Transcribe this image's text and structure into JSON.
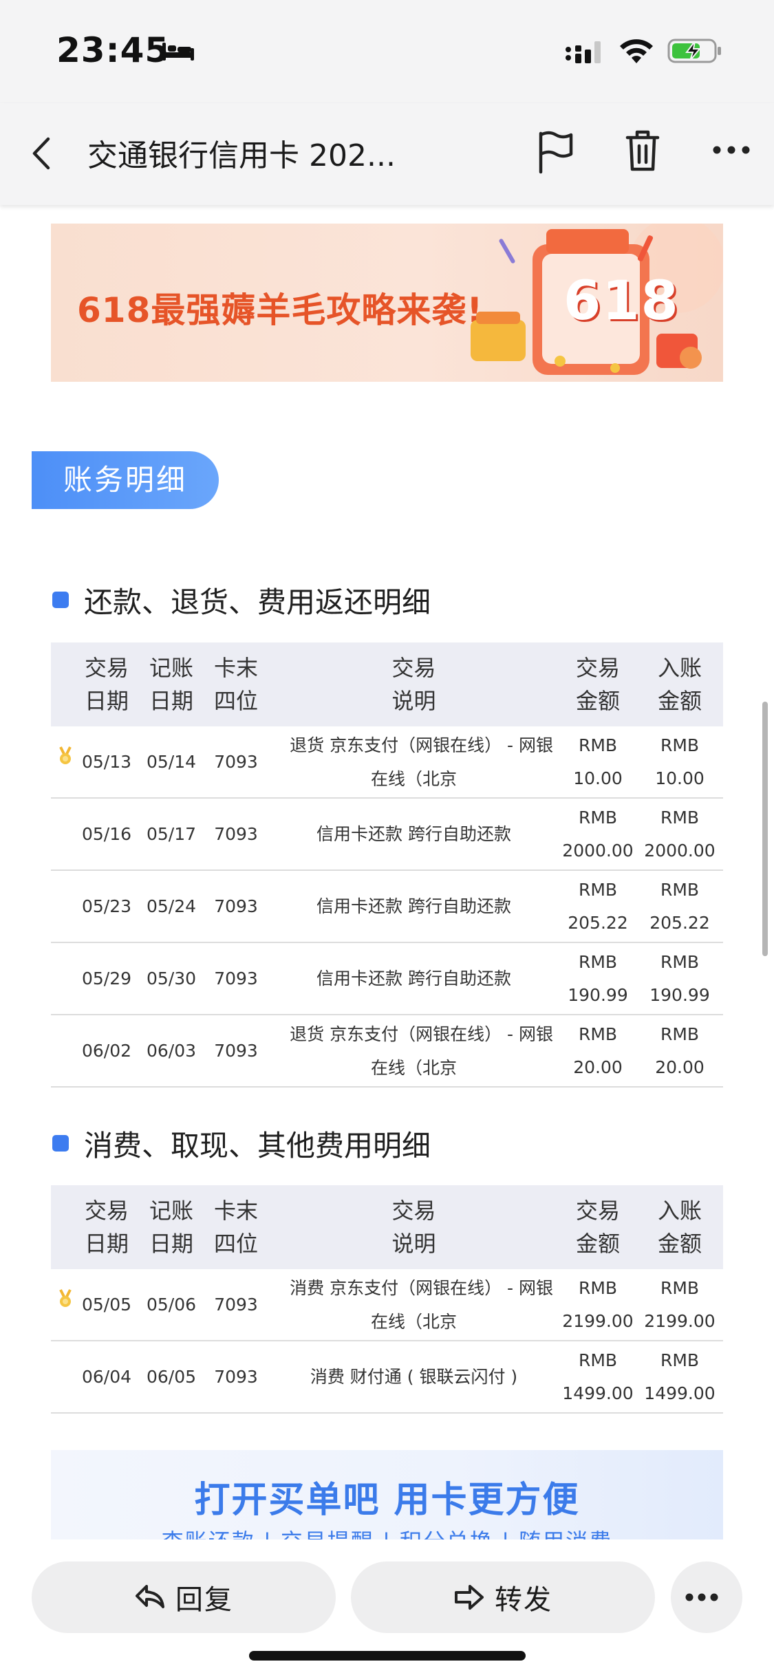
{
  "status_bar": {
    "time": "23:45"
  },
  "nav": {
    "title": "交通银行信用卡 202..."
  },
  "banner": {
    "text": "618最强薅羊毛攻略来袭!",
    "badge": "618"
  },
  "section_badge": "账务明细",
  "headers": [
    "交易\n日期",
    "记账\n日期",
    "卡末\n四位",
    "交易\n说明",
    "交易\n金额",
    "入账\n金额"
  ],
  "repayments": {
    "title": "还款、退货、费用返还明细",
    "rows": [
      {
        "trans_date": "05/13",
        "post_date": "05/14",
        "card": "7093",
        "desc1": "退货 京东支付（网银在线） - 网银",
        "desc2": "在线（北京",
        "cur": "RMB",
        "amount": "10.00",
        "cur2": "RMB",
        "posted": "10.00",
        "medal": true
      },
      {
        "trans_date": "05/16",
        "post_date": "05/17",
        "card": "7093",
        "desc1": "信用卡还款 跨行自助还款",
        "desc2": "",
        "cur": "RMB",
        "amount": "2000.00",
        "cur2": "RMB",
        "posted": "2000.00",
        "medal": false
      },
      {
        "trans_date": "05/23",
        "post_date": "05/24",
        "card": "7093",
        "desc1": "信用卡还款 跨行自助还款",
        "desc2": "",
        "cur": "RMB",
        "amount": "205.22",
        "cur2": "RMB",
        "posted": "205.22",
        "medal": false
      },
      {
        "trans_date": "05/29",
        "post_date": "05/30",
        "card": "7093",
        "desc1": "信用卡还款 跨行自助还款",
        "desc2": "",
        "cur": "RMB",
        "amount": "190.99",
        "cur2": "RMB",
        "posted": "190.99",
        "medal": false
      },
      {
        "trans_date": "06/02",
        "post_date": "06/03",
        "card": "7093",
        "desc1": "退货 京东支付（网银在线） - 网银",
        "desc2": "在线（北京",
        "cur": "RMB",
        "amount": "20.00",
        "cur2": "RMB",
        "posted": "20.00",
        "medal": false
      }
    ]
  },
  "consumption": {
    "title": "消费、取现、其他费用明细",
    "rows": [
      {
        "trans_date": "05/05",
        "post_date": "05/06",
        "card": "7093",
        "desc1": "消费 京东支付（网银在线） - 网银",
        "desc2": "在线（北京",
        "cur": "RMB",
        "amount": "2199.00",
        "cur2": "RMB",
        "posted": "2199.00",
        "medal": true
      },
      {
        "trans_date": "06/04",
        "post_date": "06/05",
        "card": "7093",
        "desc1": "消费 财付通 ( 银联云闪付 )",
        "desc2": "",
        "cur": "RMB",
        "amount": "1499.00",
        "cur2": "RMB",
        "posted": "1499.00",
        "medal": false
      }
    ]
  },
  "bottom_promo": {
    "title": "打开买单吧 用卡更方便",
    "subtitle": "查账还款 | 交易提醒 | 积分兑换 | 随用消费"
  },
  "actions": {
    "reply": "回复",
    "forward": "转发"
  },
  "colors": {
    "accent": "#3d7cf0",
    "badge": "#4d8ff7",
    "promo_orange": "#e65428"
  }
}
